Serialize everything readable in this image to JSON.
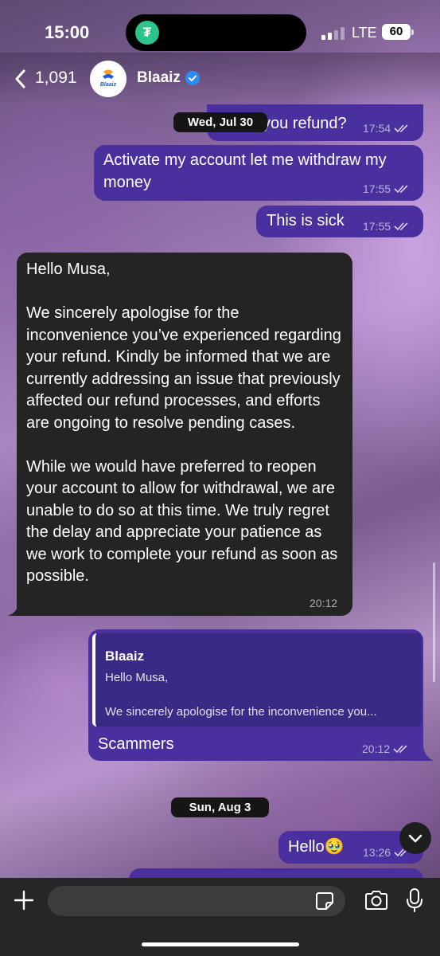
{
  "status_bar": {
    "time": "15:00",
    "network": "LTE",
    "battery": "60"
  },
  "header": {
    "back_count": "1,091",
    "contact_name": "Blaaiz",
    "avatar_text": "Blaaiz"
  },
  "messages": [
    {
      "type": "out",
      "text": "you refund?",
      "time": "17:54",
      "status": "read"
    },
    {
      "type": "out",
      "text": "Activate my account let me withdraw my money",
      "time": "17:55",
      "status": "read"
    },
    {
      "type": "out",
      "text": "This is sick",
      "time": "17:55",
      "status": "read"
    },
    {
      "type": "in",
      "text": "Hello Musa,\n\nWe sincerely apologise for the inconvenience you’ve experienced regarding your refund. Kindly be informed that we are currently addressing an issue that previously affected our refund processes, and efforts are ongoing to resolve pending cases.\n\nWhile we would have preferred to reopen your account to allow for withdrawal, we are unable to do so at this time. We truly regret the delay and appreciate your patience as we work to complete your refund as soon as possible.",
      "time": "20:12"
    },
    {
      "type": "out",
      "reply_to": {
        "name": "Blaaiz",
        "line1": "Hello Musa,",
        "line2": "We sincerely apologise for the inconvenience you..."
      },
      "text": "Scammers",
      "time": "20:12",
      "status": "read"
    },
    {
      "type": "out",
      "text": "Hello🥹",
      "time": "13:26",
      "status": "read"
    }
  ],
  "date_separators": [
    "Wed, Jul 30",
    "Sun, Aug 3"
  ],
  "composer": {
    "placeholder": ""
  },
  "colors": {
    "outgoing_bubble": "#4a2f9e",
    "incoming_bubble": "#232423",
    "verified": "#2e8cf0"
  }
}
